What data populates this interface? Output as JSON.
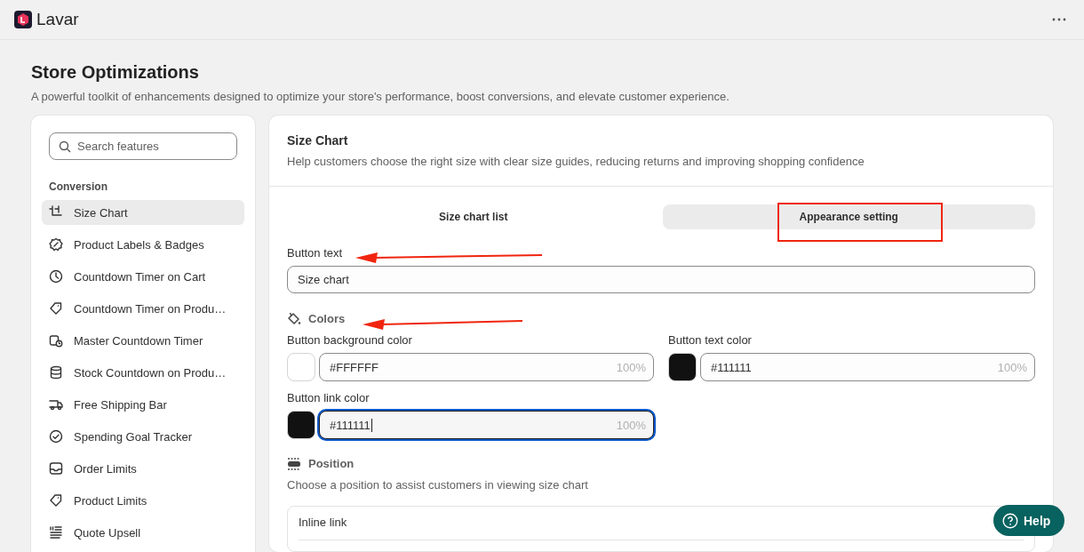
{
  "app": {
    "name": "Lavar"
  },
  "page": {
    "title": "Store Optimizations",
    "subtitle": "A powerful toolkit of enhancements designed to optimize your store's performance, boost conversions, and elevate customer experience."
  },
  "sidebar": {
    "search": {
      "placeholder": "Search features"
    },
    "section": "Conversion",
    "items": [
      {
        "label": "Size Chart",
        "selected": true
      },
      {
        "label": "Product Labels & Badges",
        "selected": false
      },
      {
        "label": "Countdown Timer on Cart",
        "selected": false
      },
      {
        "label": "Countdown Timer on Produ…",
        "selected": false
      },
      {
        "label": "Master Countdown Timer",
        "selected": false
      },
      {
        "label": "Stock Countdown on Produ…",
        "selected": false
      },
      {
        "label": "Free Shipping Bar",
        "selected": false
      },
      {
        "label": "Spending Goal Tracker",
        "selected": false
      },
      {
        "label": "Order Limits",
        "selected": false
      },
      {
        "label": "Product Limits",
        "selected": false
      },
      {
        "label": "Quote Upsell",
        "selected": false
      }
    ]
  },
  "panel": {
    "title": "Size Chart",
    "description": "Help customers choose the right size with clear size guides, reducing returns and improving shopping confidence",
    "tabs": [
      {
        "label": "Size chart list",
        "selected": false
      },
      {
        "label": "Appearance setting",
        "selected": true
      }
    ],
    "button_text": {
      "label": "Button text",
      "value": "Size chart"
    },
    "colors": {
      "title": "Colors",
      "fields": [
        {
          "label": "Button background color",
          "value": "#FFFFFF",
          "opacity": "100%",
          "color": "#ffffff",
          "focused": false
        },
        {
          "label": "Button text color",
          "value": "#111111",
          "opacity": "100%",
          "color": "#111111",
          "focused": false
        },
        {
          "label": "Button link color",
          "value": "#111111",
          "opacity": "100%",
          "color": "#111111",
          "focused": true
        }
      ]
    },
    "position": {
      "title": "Position",
      "description": "Choose a position to assist customers in viewing size chart",
      "options": [
        {
          "label": "Inline link"
        }
      ]
    }
  },
  "help": {
    "label": "Help"
  }
}
